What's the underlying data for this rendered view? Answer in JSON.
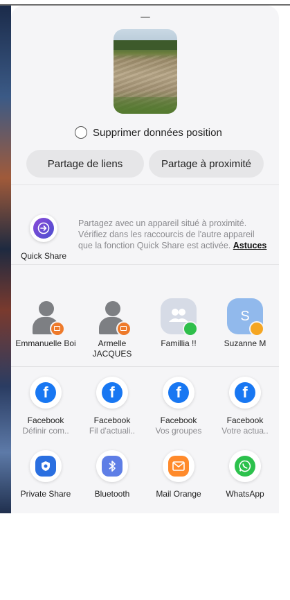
{
  "location_option": {
    "label": "Supprimer données position",
    "checked": false
  },
  "share_buttons": {
    "links": "Partage de liens",
    "nearby": "Partage à proximité"
  },
  "quick_share": {
    "label": "Quick Share",
    "description": "Partagez avec un appareil situé à proximité. Vérifiez dans les raccourcis de l'autre appareil que la fonction Quick Share est activée.",
    "link": "Astuces"
  },
  "contacts": [
    {
      "name": "Emmanuelle Boi",
      "badge": "mail-icon"
    },
    {
      "name": "Armelle JACQUES",
      "badge": "mail-icon"
    },
    {
      "name": "Famillia !!",
      "badge": "whatsapp-icon"
    },
    {
      "name": "Suzanne M",
      "initial": "S",
      "badge": "message-icon"
    }
  ],
  "apps_row1": [
    {
      "name": "Facebook",
      "sub": "Définir com.."
    },
    {
      "name": "Facebook",
      "sub": "Fil d'actuali.."
    },
    {
      "name": "Facebook",
      "sub": "Vos groupes"
    },
    {
      "name": "Facebook",
      "sub": "Votre actua.."
    }
  ],
  "apps_row2": [
    {
      "name": "Private Share",
      "icon": "private-share-icon"
    },
    {
      "name": "Bluetooth",
      "icon": "bluetooth-icon"
    },
    {
      "name": "Mail Orange",
      "icon": "mail-icon"
    },
    {
      "name": "WhatsApp",
      "icon": "whatsapp-icon"
    }
  ],
  "colors": {
    "sheet": "#f5f5f7",
    "pill": "#e6e6e8",
    "facebook": "#1877f2",
    "whatsapp": "#2cc14c",
    "mail_orange": "#ff8a2b"
  }
}
